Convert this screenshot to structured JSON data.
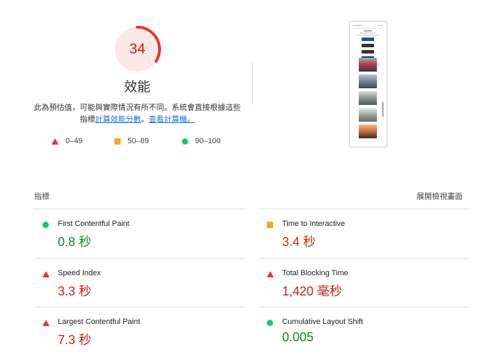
{
  "gauge": {
    "score": "34",
    "fraction": 0.34,
    "color": "#e8332d",
    "track_color": "#fce8e6"
  },
  "title": "效能",
  "note": {
    "text1": "此為預估值，可能與實際情況有所不同。系統會直接根據這些指標",
    "link1": "計算效能分數",
    "sep": "。",
    "link2": "查看計算機。"
  },
  "legend": [
    {
      "icon": "triangle",
      "range": "0–49",
      "color": "#e8332d"
    },
    {
      "icon": "square",
      "range": "50–89",
      "color": "#f4a72a"
    },
    {
      "icon": "circle",
      "range": "90–100",
      "color": "#0cce6b"
    }
  ],
  "metrics_header": {
    "left": "指標",
    "right": "展開檢視畫面"
  },
  "metrics": [
    {
      "name": "First Contentful Paint",
      "value": "0.8 秒",
      "status": "pass"
    },
    {
      "name": "Time to Interactive",
      "value": "3.4 秒",
      "status": "average"
    },
    {
      "name": "Speed Index",
      "value": "3.3 秒",
      "status": "fail"
    },
    {
      "name": "Total Blocking Time",
      "value": "1,420 毫秒",
      "status": "fail"
    },
    {
      "name": "Largest Contentful Paint",
      "value": "7.3 秒",
      "status": "fail"
    },
    {
      "name": "Cumulative Layout Shift",
      "value": "0.005",
      "status": "pass"
    }
  ]
}
